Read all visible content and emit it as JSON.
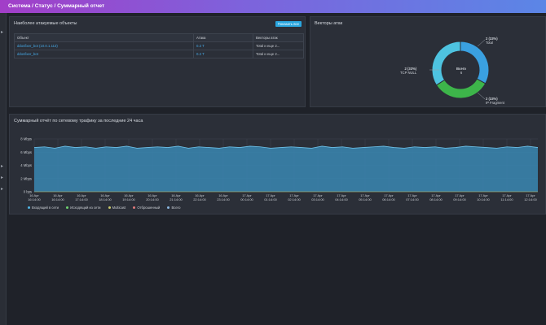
{
  "breadcrumb": "Система / Статус / Суммарный отчет",
  "top_objects": {
    "title": "Наиболее атакуемые объекты",
    "show_all_label": "Показать все",
    "columns": [
      "Объект",
      "Атака",
      "Векторы атак"
    ],
    "rows": [
      {
        "object": "ddosfixer_bot (10.0.1.113)",
        "attack": "0.2 T",
        "vectors": "Total и еще 2..."
      },
      {
        "object": "ddosfixer_bot",
        "attack": "0.2 T",
        "vectors": "Total и еще 2..."
      }
    ]
  },
  "attack_vectors": {
    "title": "Векторы атак",
    "total_label": "Всего",
    "total_value": "6",
    "segments": [
      {
        "name": "Total",
        "count": "2 (33%)",
        "value": 33,
        "color": "#3aa0e0"
      },
      {
        "name": "IP Fragment",
        "count": "2 (33%)",
        "value": 33,
        "color": "#3db54a"
      },
      {
        "name": "TCP NULL",
        "count": "2 (33%)",
        "value": 34,
        "color": "#4ec3e0"
      }
    ]
  },
  "traffic": {
    "title": "Суммарный отчёт по сетевому трафику за последние 24 часа",
    "y_ticks": [
      "0 bps",
      "2 Mbps",
      "4 Mbps",
      "6 Mbps",
      "8 Mbps"
    ],
    "x_ticks": [
      {
        "d": "16 Apr",
        "t": "16:14:00"
      },
      {
        "d": "16 Apr",
        "t": "16:14:00"
      },
      {
        "d": "16 Apr",
        "t": "17:14:00"
      },
      {
        "d": "16 Apr",
        "t": "18:14:00"
      },
      {
        "d": "16 Apr",
        "t": "19:14:00"
      },
      {
        "d": "16 Apr",
        "t": "20:14:00"
      },
      {
        "d": "16 Apr",
        "t": "21:14:00"
      },
      {
        "d": "16 Apr",
        "t": "22:14:00"
      },
      {
        "d": "16 Apr",
        "t": "23:14:00"
      },
      {
        "d": "17 Apr",
        "t": "00:14:00"
      },
      {
        "d": "17 Apr",
        "t": "01:14:00"
      },
      {
        "d": "17 Apr",
        "t": "02:14:00"
      },
      {
        "d": "17 Apr",
        "t": "03:14:00"
      },
      {
        "d": "17 Apr",
        "t": "04:14:00"
      },
      {
        "d": "17 Apr",
        "t": "05:14:00"
      },
      {
        "d": "17 Apr",
        "t": "06:14:00"
      },
      {
        "d": "17 Apr",
        "t": "07:14:00"
      },
      {
        "d": "17 Apr",
        "t": "08:14:00"
      },
      {
        "d": "17 Apr",
        "t": "09:14:00"
      },
      {
        "d": "17 Apr",
        "t": "10:14:00"
      },
      {
        "d": "17 Apr",
        "t": "11:14:00"
      },
      {
        "d": "17 Apr",
        "t": "12:14:00"
      },
      {
        "d": "17 Apr",
        "t": "13:14:00"
      }
    ],
    "legend": [
      {
        "name": "Входящий в сети",
        "color": "#4fb6e6"
      },
      {
        "name": "Исходящий из сети",
        "color": "#6fd36f"
      },
      {
        "name": "Multicast",
        "color": "#c9c96a"
      },
      {
        "name": "Отброшенный",
        "color": "#e07a7a"
      },
      {
        "name": "Всего",
        "color": "#8ab6e0"
      }
    ]
  },
  "chart_data": {
    "type": "area",
    "title": "Суммарный отчёт по сетевому трафику за последние 24 часа",
    "xlabel": "",
    "ylabel": "",
    "ylim": [
      0,
      8
    ],
    "y_unit": "Mbps",
    "x_range": [
      "16 Apr 15:14",
      "17 Apr 13:30"
    ],
    "series": [
      {
        "name": "Всего",
        "values": [
          6.7,
          6.8,
          6.6,
          6.9,
          6.7,
          6.8,
          6.6,
          6.8,
          6.7,
          6.9,
          6.6,
          6.7,
          6.8,
          6.7,
          6.9,
          6.6,
          6.8,
          6.7,
          6.6,
          6.8,
          6.7,
          6.9,
          6.8,
          6.6,
          6.7,
          6.8,
          6.7,
          6.6,
          6.9,
          6.7,
          6.8,
          6.6,
          6.7,
          6.8,
          6.9,
          6.7,
          6.6,
          6.8,
          6.7,
          6.8,
          6.6,
          6.7,
          6.9,
          6.8,
          6.7,
          6.6,
          6.8,
          6.7,
          6.9,
          6.7
        ]
      }
    ],
    "grid": true
  }
}
